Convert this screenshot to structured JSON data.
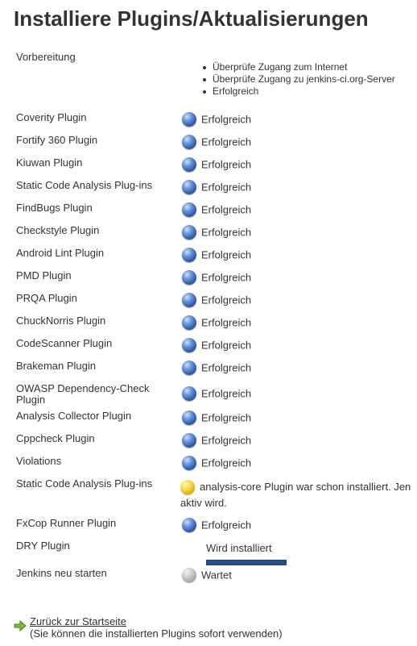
{
  "title": "Installiere Plugins/Aktualisierungen",
  "preparation": {
    "label": "Vorbereitung",
    "items": [
      "Überprüfe Zugang zum Internet",
      "Überprüfe Zugang zu jenkins-ci.org-Server",
      "Erfolgreich"
    ]
  },
  "rows": [
    {
      "name": "Coverity Plugin",
      "status": "Erfolgreich",
      "icon": "blue-ball-icon"
    },
    {
      "name": "Fortify 360 Plugin",
      "status": "Erfolgreich",
      "icon": "blue-ball-icon"
    },
    {
      "name": "Kiuwan Plugin",
      "status": "Erfolgreich",
      "icon": "blue-ball-icon"
    },
    {
      "name": "Static Code Analysis Plug-ins",
      "status": "Erfolgreich",
      "icon": "blue-ball-icon"
    },
    {
      "name": "FindBugs Plugin",
      "status": "Erfolgreich",
      "icon": "blue-ball-icon"
    },
    {
      "name": "Checkstyle Plugin",
      "status": "Erfolgreich",
      "icon": "blue-ball-icon"
    },
    {
      "name": "Android Lint Plugin",
      "status": "Erfolgreich",
      "icon": "blue-ball-icon"
    },
    {
      "name": "PMD Plugin",
      "status": "Erfolgreich",
      "icon": "blue-ball-icon"
    },
    {
      "name": "PRQA Plugin",
      "status": "Erfolgreich",
      "icon": "blue-ball-icon"
    },
    {
      "name": "ChuckNorris Plugin",
      "status": "Erfolgreich",
      "icon": "blue-ball-icon"
    },
    {
      "name": "CodeScanner Plugin",
      "status": "Erfolgreich",
      "icon": "blue-ball-icon"
    },
    {
      "name": "Brakeman Plugin",
      "status": "Erfolgreich",
      "icon": "blue-ball-icon"
    },
    {
      "name": "OWASP Dependency-Check Plugin",
      "status": "Erfolgreich",
      "icon": "blue-ball-icon"
    },
    {
      "name": "Analysis Collector Plugin",
      "status": "Erfolgreich",
      "icon": "blue-ball-icon"
    },
    {
      "name": "Cppcheck Plugin",
      "status": "Erfolgreich",
      "icon": "blue-ball-icon"
    },
    {
      "name": "Violations",
      "status": "Erfolgreich",
      "icon": "blue-ball-icon"
    },
    {
      "name": "Static Code Analysis Plug-ins",
      "status_line1": "analysis-core Plugin war schon installiert. Jen",
      "status_line2": "aktiv wird.",
      "icon": "yellow-ball-icon"
    },
    {
      "name": "FxCop Runner Plugin",
      "status": "Erfolgreich",
      "icon": "blue-ball-icon"
    },
    {
      "name": "DRY Plugin",
      "status": "Wird installiert",
      "progress": 1.0
    },
    {
      "name": "Jenkins neu starten",
      "status": "Wartet",
      "icon": "grey-ball-icon"
    }
  ],
  "footer": {
    "back_link": "Zurück zur Startseite",
    "note": "(Sie können die installierten Plugins sofort verwenden)"
  },
  "colors": {
    "text": "#333333",
    "success": "#2f5fae",
    "warning": "#e6b400",
    "pending": "#a9a9a9",
    "progress": "#29507f"
  }
}
